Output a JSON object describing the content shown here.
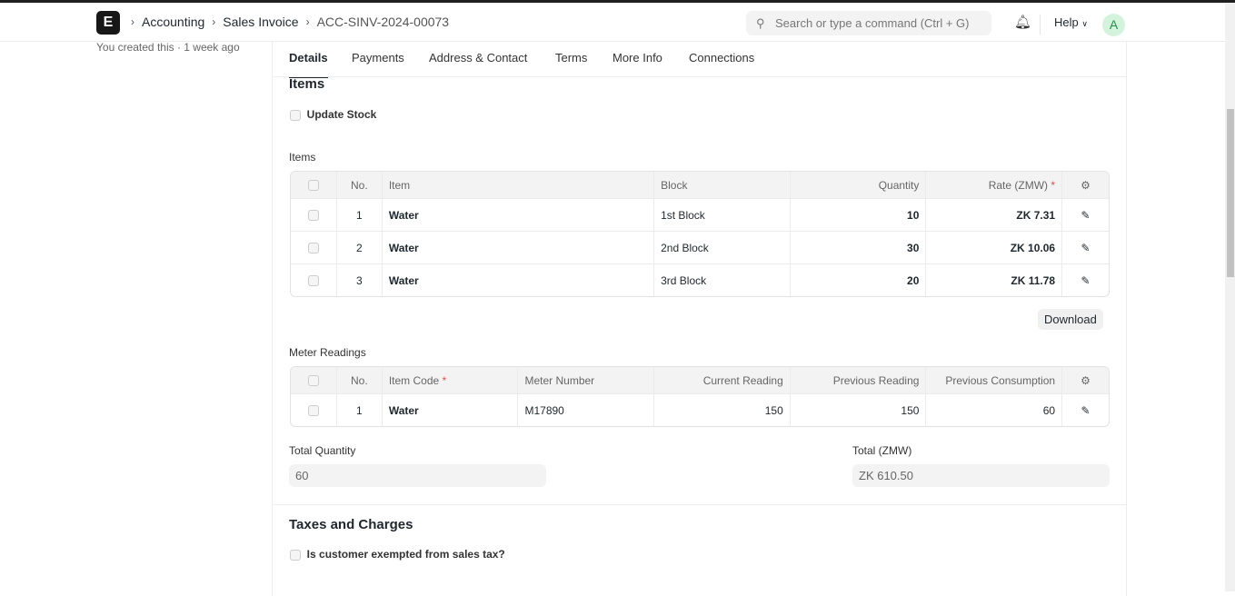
{
  "breadcrumbs": [
    "Accounting",
    "Sales Invoice",
    "ACC-SINV-2024-00073"
  ],
  "logo": "E",
  "search_placeholder": "Search or type a command (Ctrl + G)",
  "help": "Help",
  "avatar": "A",
  "meta": "You created this · 1 week ago",
  "tabs": [
    "Details",
    "Payments",
    "Address & Contact",
    "Terms",
    "More Info",
    "Connections"
  ],
  "items_section": {
    "title": "Items",
    "update_stock": "Update Stock",
    "table_label": "Items",
    "headers": [
      "No.",
      "Item",
      "Block",
      "Quantity",
      "Rate (ZMW)"
    ],
    "rows": [
      [
        "1",
        "Water",
        "1st Block",
        "10",
        "ZK 7.31"
      ],
      [
        "2",
        "Water",
        "2nd Block",
        "30",
        "ZK 10.06"
      ],
      [
        "3",
        "Water",
        "3rd Block",
        "20",
        "ZK 11.78"
      ]
    ],
    "download": "Download"
  },
  "meter": {
    "label": "Meter Readings",
    "headers": [
      "No.",
      "Item Code",
      "Meter Number",
      "Current Reading",
      "Previous Reading",
      "Previous Consumption"
    ],
    "rows": [
      [
        "1",
        "Water",
        "M17890",
        "150",
        "150",
        "60"
      ]
    ]
  },
  "totals": {
    "qty_label": "Total Quantity",
    "qty": "60",
    "total_label": "Total (ZMW)",
    "total": "ZK 610.50"
  },
  "taxes": {
    "title": "Taxes and Charges",
    "exempt": "Is customer exempted from sales tax?"
  }
}
